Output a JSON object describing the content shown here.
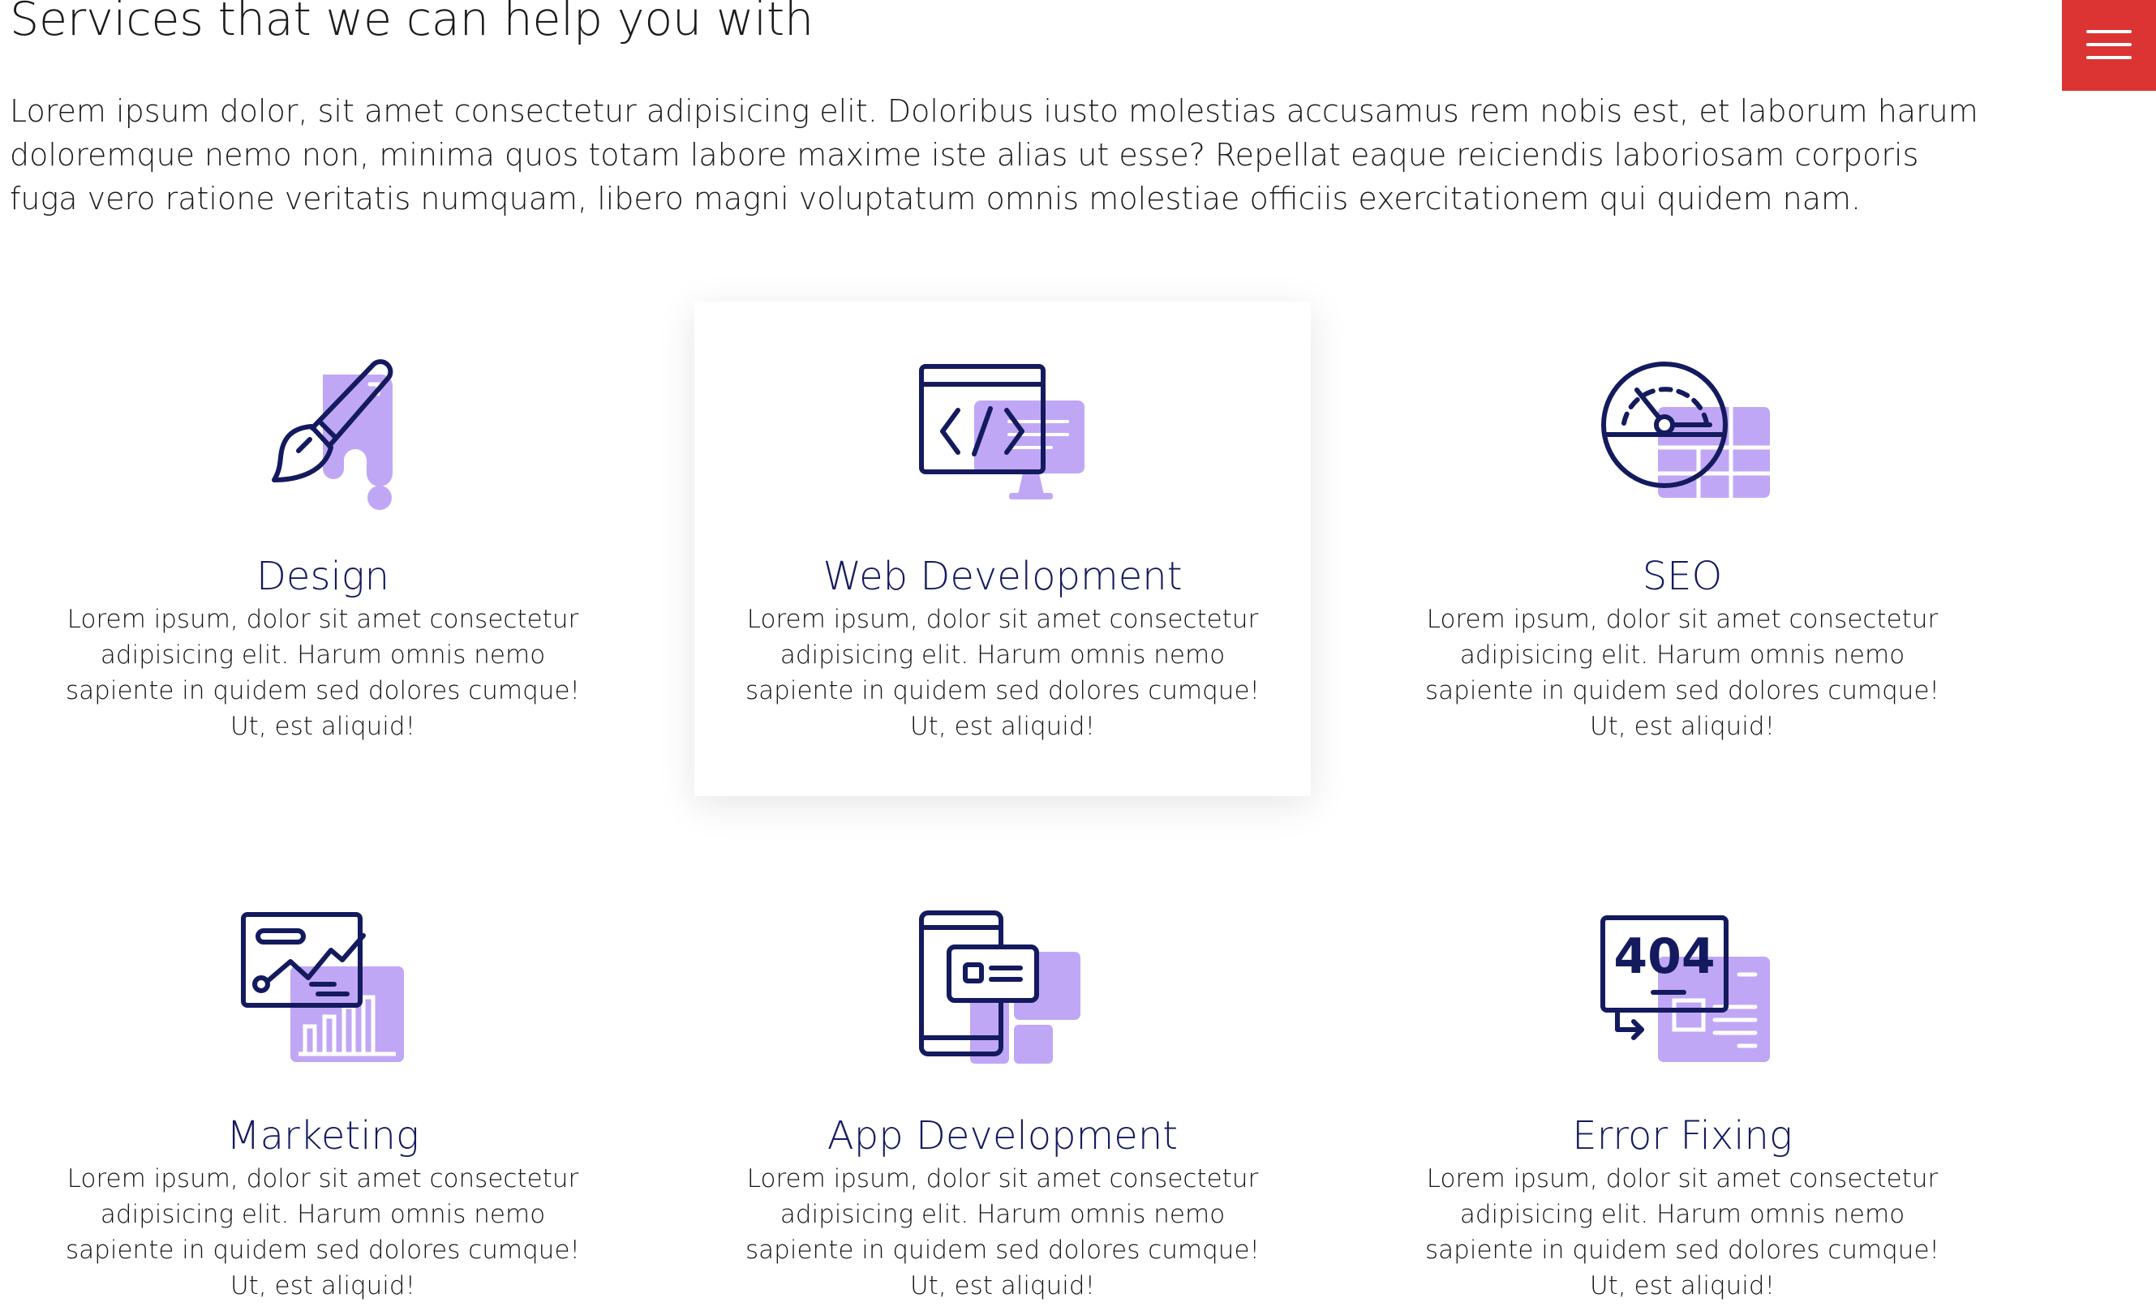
{
  "header": {
    "title": "Services that we can help you with",
    "intro": "Lorem ipsum dolor, sit amet consectetur adipisicing elit. Doloribus iusto molestias accusamus rem nobis est, et laborum harum doloremque nemo non, minima quos totam labore maxime iste alias ut esse? Repellat eaque reiciendis laboriosam corporis fuga vero ratione veritatis numquam, libero magni voluptatum omnis molestiae officiis exercitationem qui quidem nam."
  },
  "menu": {
    "icon": "hamburger-menu-icon",
    "color": "#dc3433"
  },
  "colors": {
    "icon_primary": "#141a5e",
    "icon_accent": "#c0a7f5",
    "title": "#141a5e"
  },
  "services": [
    {
      "icon": "design-brush-icon",
      "title": "Design",
      "description": "Lorem ipsum, dolor sit amet consectetur adipisicing elit. Harum omnis nemo sapiente in quidem sed dolores cumque! Ut, est aliquid!"
    },
    {
      "icon": "web-development-monitor-icon",
      "title": "Web Development",
      "description": "Lorem ipsum, dolor sit amet consectetur adipisicing elit. Harum omnis nemo sapiente in quidem sed dolores cumque! Ut, est aliquid!"
    },
    {
      "icon": "seo-gauge-icon",
      "title": "SEO",
      "description": "Lorem ipsum, dolor sit amet consectetur adipisicing elit. Harum omnis nemo sapiente in quidem sed dolores cumque! Ut, est aliquid!"
    },
    {
      "icon": "marketing-chart-icon",
      "title": "Marketing",
      "description": "Lorem ipsum, dolor sit amet consectetur adipisicing elit. Harum omnis nemo sapiente in quidem sed dolores cumque! Ut, est aliquid!"
    },
    {
      "icon": "app-development-phone-icon",
      "title": "App Development",
      "description": "Lorem ipsum, dolor sit amet consectetur adipisicing elit. Harum omnis nemo sapiente in quidem sed dolores cumque! Ut, est aliquid!"
    },
    {
      "icon": "error-404-icon",
      "title": "Error Fixing",
      "icon_text": "404",
      "description": "Lorem ipsum, dolor sit amet consectetur adipisicing elit. Harum omnis nemo sapiente in quidem sed dolores cumque! Ut, est aliquid!"
    }
  ]
}
